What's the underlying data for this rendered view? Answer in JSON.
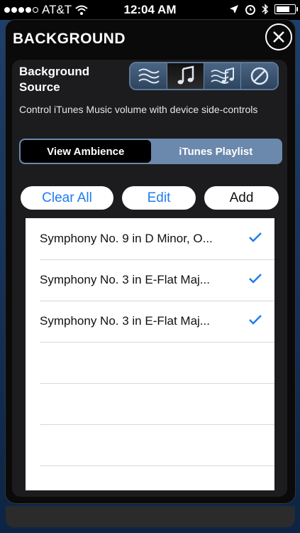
{
  "status_bar": {
    "carrier": "AT&T",
    "time": "12:04 AM",
    "signal_bars_filled": 4,
    "signal_bars_total": 5,
    "battery_level": 0.8
  },
  "panel": {
    "title": "BACKGROUND",
    "close_icon": "close-icon"
  },
  "source": {
    "label": "Background Source",
    "options": [
      {
        "icon": "waves-icon",
        "selected": false
      },
      {
        "icon": "music-note-icon",
        "selected": true
      },
      {
        "icon": "waves-music-icon",
        "selected": false
      },
      {
        "icon": "none-icon",
        "selected": false
      }
    ]
  },
  "description": "Control iTunes Music volume with device side-controls",
  "mode_tabs": {
    "view_ambience": "View Ambience",
    "itunes_playlist": "iTunes Playlist",
    "selected": "View Ambience"
  },
  "actions": {
    "clear_all": "Clear All",
    "edit": "Edit",
    "add": "Add"
  },
  "playlist": {
    "items": [
      {
        "title": "Symphony No. 9 in D Minor, O...",
        "checked": true
      },
      {
        "title": "Symphony No. 3 in E-Flat Maj...",
        "checked": true
      },
      {
        "title": "Symphony No. 3 in E-Flat Maj...",
        "checked": true
      }
    ]
  },
  "colors": {
    "accent_blue": "#1e7cf2",
    "segment_blue": "#6b88ad",
    "frame_blue": "#1d3f6b"
  }
}
